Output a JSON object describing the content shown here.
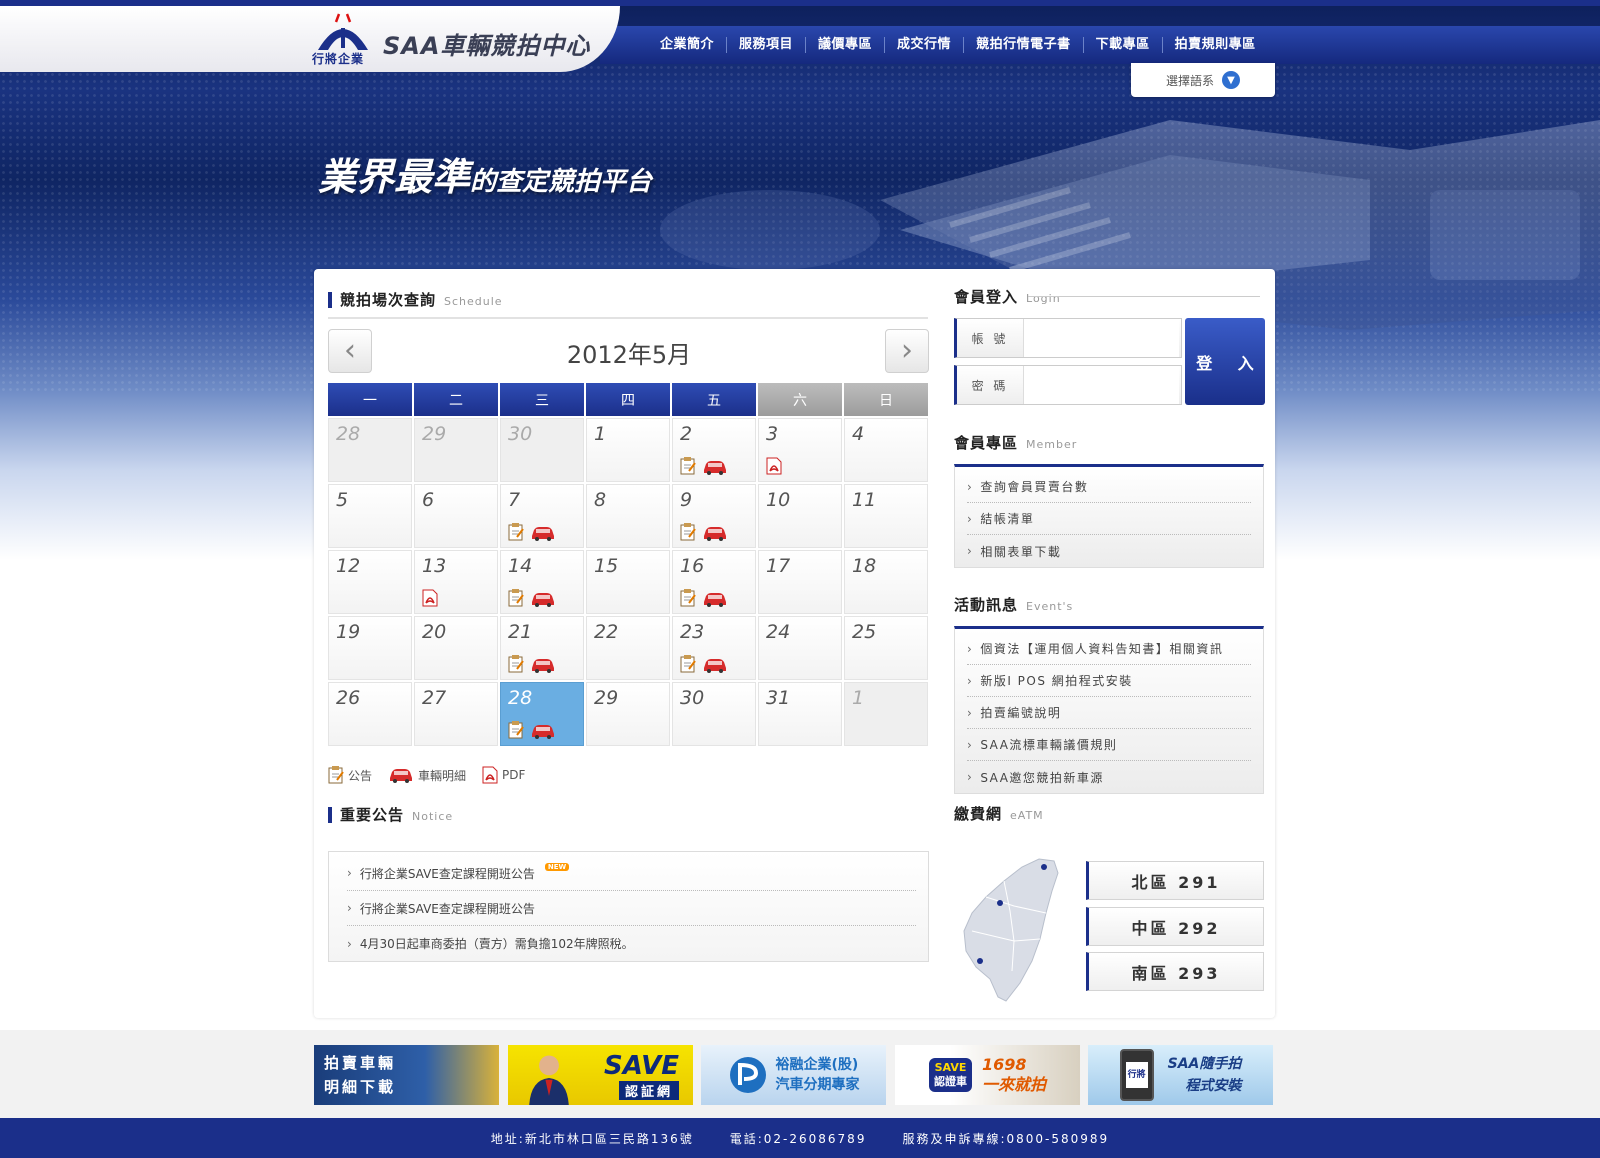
{
  "header": {
    "logo_sub": "行將企業",
    "site_title": "SAA車輛競拍中心",
    "nav": [
      "企業簡介",
      "服務項目",
      "議價專區",
      "成交行情",
      "競拍行情電子書",
      "下載專區",
      "拍賣規則專區"
    ],
    "language_label": "選擇語系"
  },
  "hero": {
    "slogan_big": "業界最準",
    "slogan_small": "的查定競拍平台"
  },
  "schedule": {
    "title": "競拍場次查詢",
    "title_en": "Schedule",
    "month_label": "2012年5月",
    "weekdays": [
      "一",
      "二",
      "三",
      "四",
      "五",
      "六",
      "日"
    ],
    "days": [
      {
        "n": "28",
        "other": true,
        "icons": []
      },
      {
        "n": "29",
        "other": true,
        "icons": []
      },
      {
        "n": "30",
        "other": true,
        "icons": []
      },
      {
        "n": "1",
        "icons": []
      },
      {
        "n": "2",
        "icons": [
          "note",
          "car"
        ]
      },
      {
        "n": "3",
        "icons": [
          "pdf"
        ]
      },
      {
        "n": "4",
        "icons": []
      },
      {
        "n": "5",
        "icons": []
      },
      {
        "n": "6",
        "icons": []
      },
      {
        "n": "7",
        "icons": [
          "note",
          "car"
        ]
      },
      {
        "n": "8",
        "icons": []
      },
      {
        "n": "9",
        "icons": [
          "note",
          "car"
        ]
      },
      {
        "n": "10",
        "icons": []
      },
      {
        "n": "11",
        "icons": []
      },
      {
        "n": "12",
        "icons": []
      },
      {
        "n": "13",
        "icons": [
          "pdf"
        ]
      },
      {
        "n": "14",
        "icons": [
          "note",
          "car"
        ]
      },
      {
        "n": "15",
        "icons": []
      },
      {
        "n": "16",
        "icons": [
          "note",
          "car"
        ]
      },
      {
        "n": "17",
        "icons": []
      },
      {
        "n": "18",
        "icons": []
      },
      {
        "n": "19",
        "icons": []
      },
      {
        "n": "20",
        "icons": []
      },
      {
        "n": "21",
        "icons": [
          "note",
          "car"
        ]
      },
      {
        "n": "22",
        "icons": []
      },
      {
        "n": "23",
        "icons": [
          "note",
          "car"
        ]
      },
      {
        "n": "24",
        "icons": []
      },
      {
        "n": "25",
        "icons": []
      },
      {
        "n": "26",
        "icons": []
      },
      {
        "n": "27",
        "icons": []
      },
      {
        "n": "28",
        "today": true,
        "icons": [
          "note",
          "car"
        ]
      },
      {
        "n": "29",
        "icons": []
      },
      {
        "n": "30",
        "icons": []
      },
      {
        "n": "31",
        "icons": []
      },
      {
        "n": "1",
        "other": true,
        "icons": []
      }
    ],
    "legend": {
      "note": "公告",
      "car": "車輛明細",
      "pdf": "PDF"
    }
  },
  "notice": {
    "title": "重要公告",
    "title_en": "Notice",
    "new_badge": "NEW",
    "items": [
      "行將企業SAVE查定課程開班公告",
      "行將企業SAVE查定課程開班公告",
      "4月30日起車商委拍（賣方）需負擔102年牌照稅。"
    ]
  },
  "login": {
    "title": "會員登入",
    "title_en": "Login",
    "account_label": "帳 號",
    "password_label": "密 碼",
    "button": "登 入"
  },
  "member": {
    "title": "會員專區",
    "title_en": "Member",
    "items": [
      "查詢會員買賣台數",
      "結帳清單",
      "相關表單下載"
    ]
  },
  "events": {
    "title": "活動訊息",
    "title_en": "Event's",
    "items": [
      "個資法【運用個人資料告知書】相關資訊",
      "新版I POS 網拍程式安裝",
      "拍賣編號說明",
      "SAA流標車輛議價規則",
      "SAA邀您競拍新車源"
    ]
  },
  "eatm": {
    "title": "繳費網",
    "title_en": "eATM",
    "regions": [
      "北區 291",
      "中區 292",
      "南區 293"
    ]
  },
  "banners": {
    "b1": "拍賣車輛\n明細下載",
    "b2": "SAVE",
    "b2_sub": "認証網",
    "b3": "裕融企業(股)\n汽車分期專家",
    "b4_badge": "SAVE",
    "b4_badge_sub": "認證車",
    "b4": "1698\n一來就拍",
    "b5_badge": "行將",
    "b5": "SAA隨手拍\n程式安裝"
  },
  "footer": {
    "address": "地址:新北市林口區三民路136號",
    "phone": "電話:02-26086789",
    "hotline": "服務及申訴專線:0800-580989"
  },
  "colors": {
    "brand_blue": "#1b2f8a",
    "today_highlight": "#6aaee2"
  }
}
